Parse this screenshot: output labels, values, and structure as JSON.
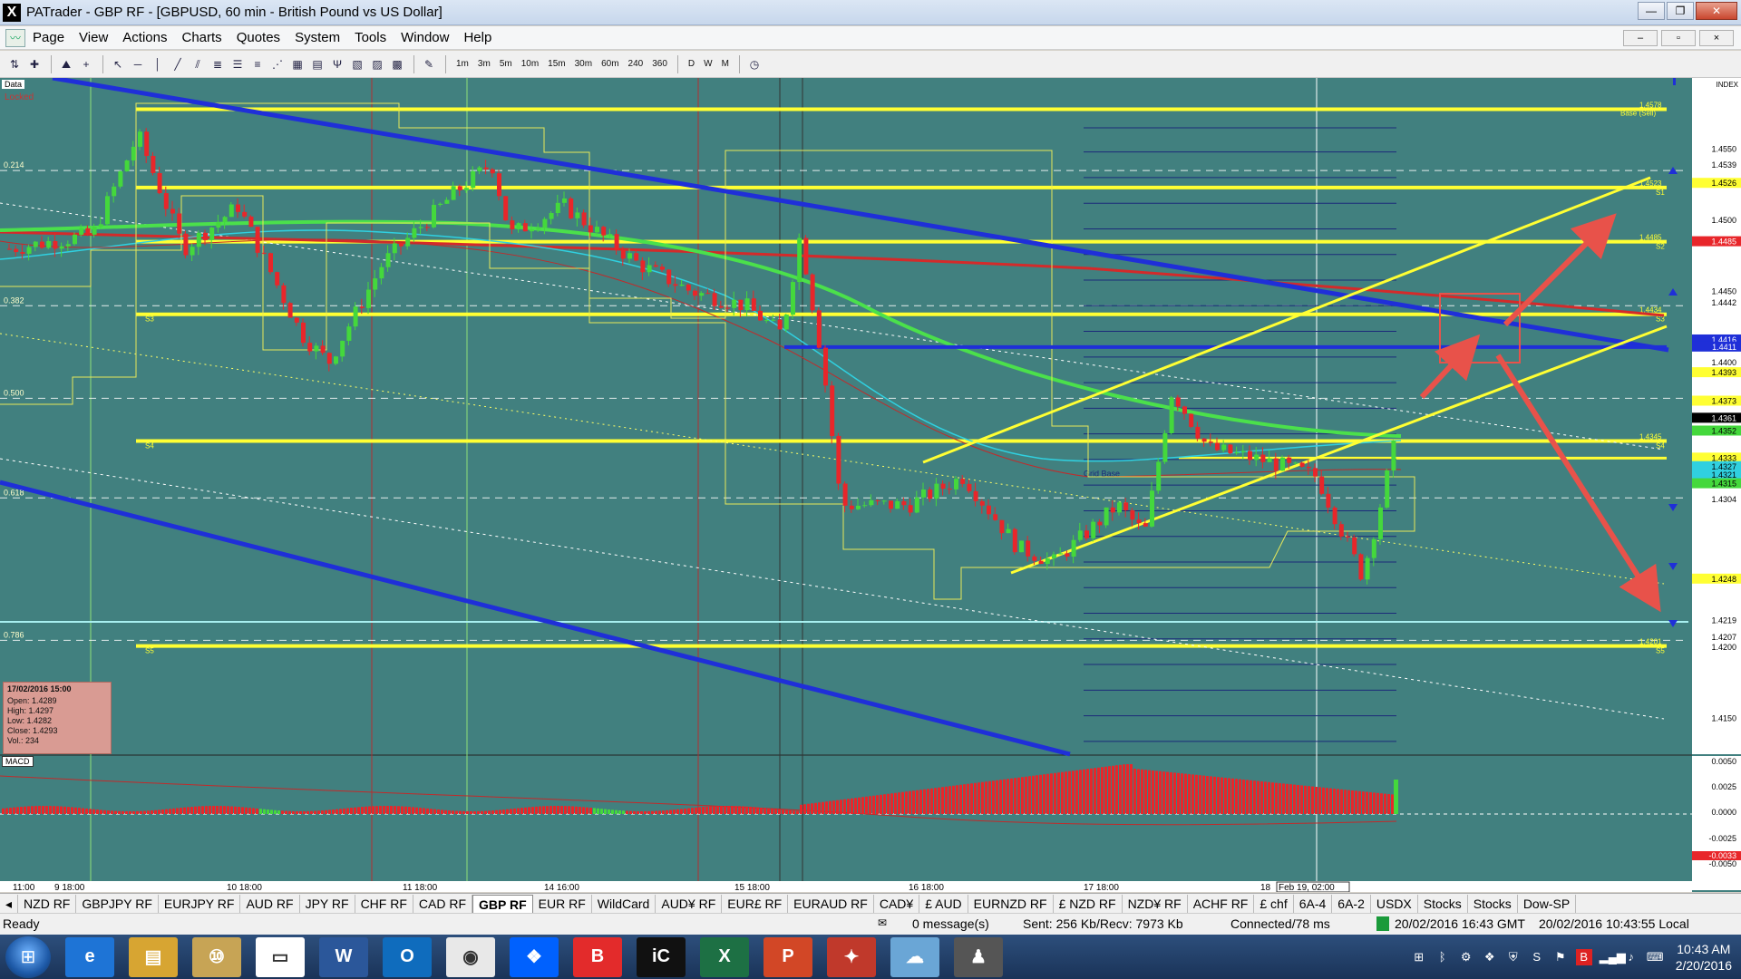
{
  "window": {
    "title": "PATrader - GBP RF - [GBPUSD, 60 min - British Pound vs US Dollar]",
    "app_icon": "X",
    "controls": [
      "—",
      "❐",
      "✕"
    ]
  },
  "menu": {
    "items": [
      "Page",
      "View",
      "Actions",
      "Charts",
      "Quotes",
      "System",
      "Tools",
      "Window",
      "Help"
    ],
    "mdi_controls": [
      "–",
      "▫",
      "×"
    ]
  },
  "toolbar": {
    "timeframes": [
      "1m",
      "3m",
      "5m",
      "10m",
      "15m",
      "30m",
      "60m",
      "240",
      "360",
      "D",
      "W",
      "M"
    ]
  },
  "chart": {
    "tags": {
      "data": "Data",
      "locked": "Locked",
      "macd": "MACD",
      "grid_base": "Grid Base",
      "index": "INDEX"
    },
    "fib_levels": [
      "0.214",
      "0.382",
      "0.500",
      "0.618",
      "0.786"
    ],
    "level_labels": {
      "base_sell": "Base (Sell)",
      "s1": "S1",
      "s2": "S2",
      "s3": "S3",
      "s4": "S4",
      "s5": "S5",
      "v14578": "1.4578",
      "v14523": "1.4523",
      "v14485": "1.4485",
      "v14434": "1.4434",
      "v14345": "1.4345",
      "v14201": "1.4201"
    },
    "price_axis": [
      "1.4550",
      "1.4539",
      "1.4526",
      "1.4500",
      "1.4485",
      "1.4450",
      "1.4442",
      "1.4416",
      "1.4411",
      "1.4400",
      "1.4393",
      "1.4373",
      "1.4361",
      "1.4352",
      "1.4333",
      "1.4327",
      "1.4321",
      "1.4315",
      "1.4304",
      "1.4248",
      "1.4219",
      "1.4207",
      "1.4200",
      "1.4150"
    ],
    "macd_axis": [
      "0.0050",
      "0.0025",
      "0.0000",
      "-0.0025",
      "-0.0050"
    ],
    "macd_value": "-0.0033",
    "time_axis": [
      "11:00",
      "9 18:00",
      "10 18:00",
      "11 18:00",
      "14 16:00",
      "15 18:00",
      "16 18:00",
      "17 18:00",
      "18",
      "Feb 19, 02:00"
    ],
    "infobox": {
      "date": "17/02/2016 15:00",
      "open": "Open: 1.4289",
      "high": "High: 1.4297",
      "low": "Low: 1.4282",
      "close": "Close: 1.4293",
      "vol": "Vol.: 234"
    },
    "colors": {
      "bg": "#41807f",
      "up": "#44d83c",
      "down": "#e8262a",
      "yellow": "#ffff33",
      "blue": "#1f2fd8",
      "red": "#d43a3a",
      "arrow": "#e8524a"
    }
  },
  "symbol_tabs": [
    "NZD RF",
    "GBPJPY RF",
    "EURJPY RF",
    "AUD RF",
    "JPY RF",
    "CHF RF",
    "CAD RF",
    "GBP RF",
    "EUR RF",
    "WildCard",
    "AUD¥ RF",
    "EUR£ RF",
    "EURAUD RF",
    "CAD¥",
    "£ AUD",
    "EURNZD RF",
    "£ NZD RF",
    "NZD¥ RF",
    "ACHF RF",
    "£ chf",
    "6A-4",
    "6A-2",
    "USDX",
    "Stocks",
    "Stocks",
    "Dow-SP"
  ],
  "active_tab": "GBP RF",
  "status": {
    "ready": "Ready",
    "messages": "0 message(s)",
    "traffic": "Sent: 256 Kb/Recv: 7973 Kb",
    "connection": "Connected/78 ms",
    "gmt": "20/02/2016 16:43 GMT",
    "local": "20/02/2016 10:43:55 Local"
  },
  "taskbar": {
    "apps": [
      "e",
      "▤",
      "⑩",
      "▭",
      "W",
      "O",
      "◉",
      "❖",
      "B",
      "iC",
      "X",
      "P",
      "✦",
      "☁",
      "♟"
    ],
    "time": "10:43 AM",
    "date": "2/20/2016"
  }
}
